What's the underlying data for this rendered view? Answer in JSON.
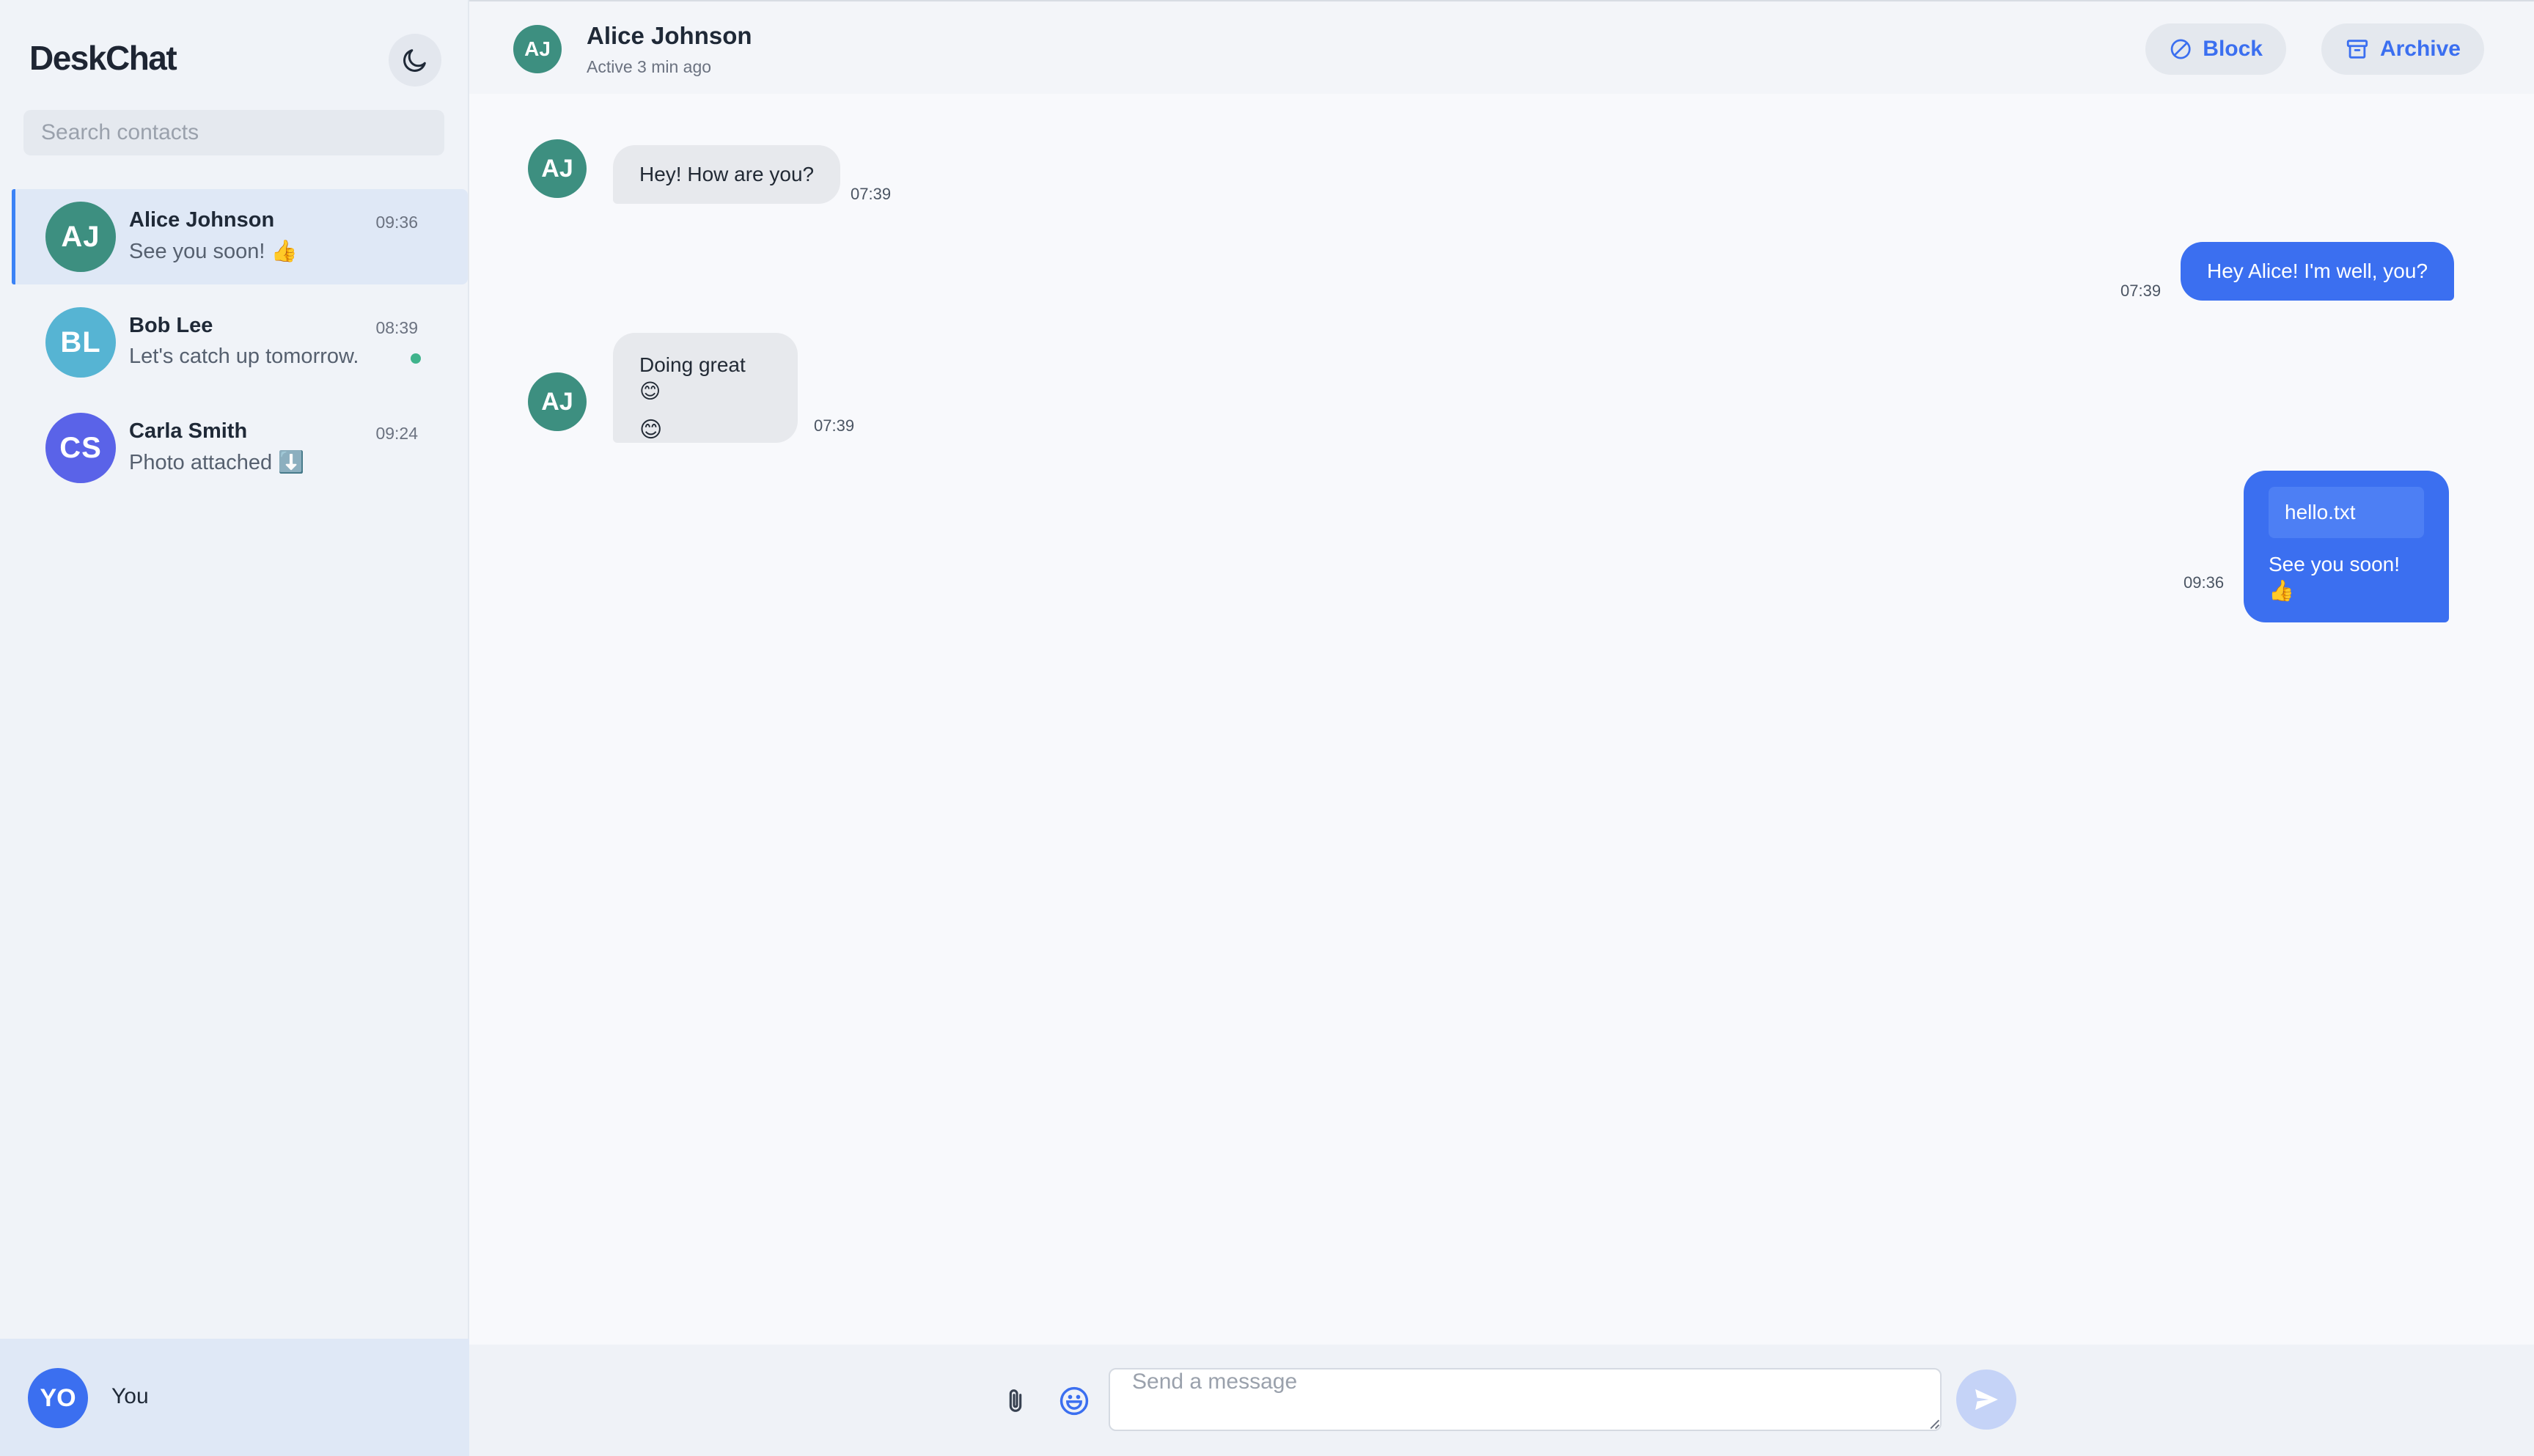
{
  "app": {
    "brand": "DeskChat"
  },
  "sidebar": {
    "search_placeholder": "Search contacts",
    "theme_icon": "moon-icon",
    "contacts": [
      {
        "initials": "AJ",
        "name": "Alice Johnson",
        "preview": "See you soon! 👍",
        "time": "09:36",
        "avatar_color": "#3d8f80",
        "active": true,
        "unread": false
      },
      {
        "initials": "BL",
        "name": "Bob Lee",
        "preview": "Let's catch up tomorrow.",
        "time": "08:39",
        "avatar_color": "#56b4d3",
        "active": false,
        "unread": true
      },
      {
        "initials": "CS",
        "name": "Carla Smith",
        "preview": "Photo attached ⬇️",
        "time": "09:24",
        "avatar_color": "#5a63e8",
        "active": false,
        "unread": false
      }
    ],
    "me": {
      "initials": "YO",
      "name": "You",
      "avatar_color": "#3b6ff0"
    }
  },
  "chat": {
    "header": {
      "initials": "AJ",
      "name": "Alice Johnson",
      "status": "Active 3 min ago",
      "block_label": "Block",
      "archive_label": "Archive"
    },
    "messages": [
      {
        "direction": "in",
        "sender_initials": "AJ",
        "text": "Hey! How are you?",
        "time": "07:39"
      },
      {
        "direction": "out",
        "text": "Hey Alice! I'm well, you?",
        "time": "07:39"
      },
      {
        "direction": "in",
        "sender_initials": "AJ",
        "text": "Doing great 😊",
        "reaction": "😊",
        "time": "07:39"
      },
      {
        "direction": "out",
        "attachment": "hello.txt",
        "text": "See you soon! 👍",
        "time": "09:36"
      }
    ],
    "composer": {
      "placeholder": "Send a message",
      "attach_icon": "paperclip-icon",
      "emoji_icon": "smile-icon",
      "send_icon": "send-icon"
    }
  },
  "colors": {
    "accent": "#3b6ff0",
    "online": "#3fb38c",
    "sidebar_bg": "#f0f3f8",
    "active_row": "#dfe8f6"
  }
}
